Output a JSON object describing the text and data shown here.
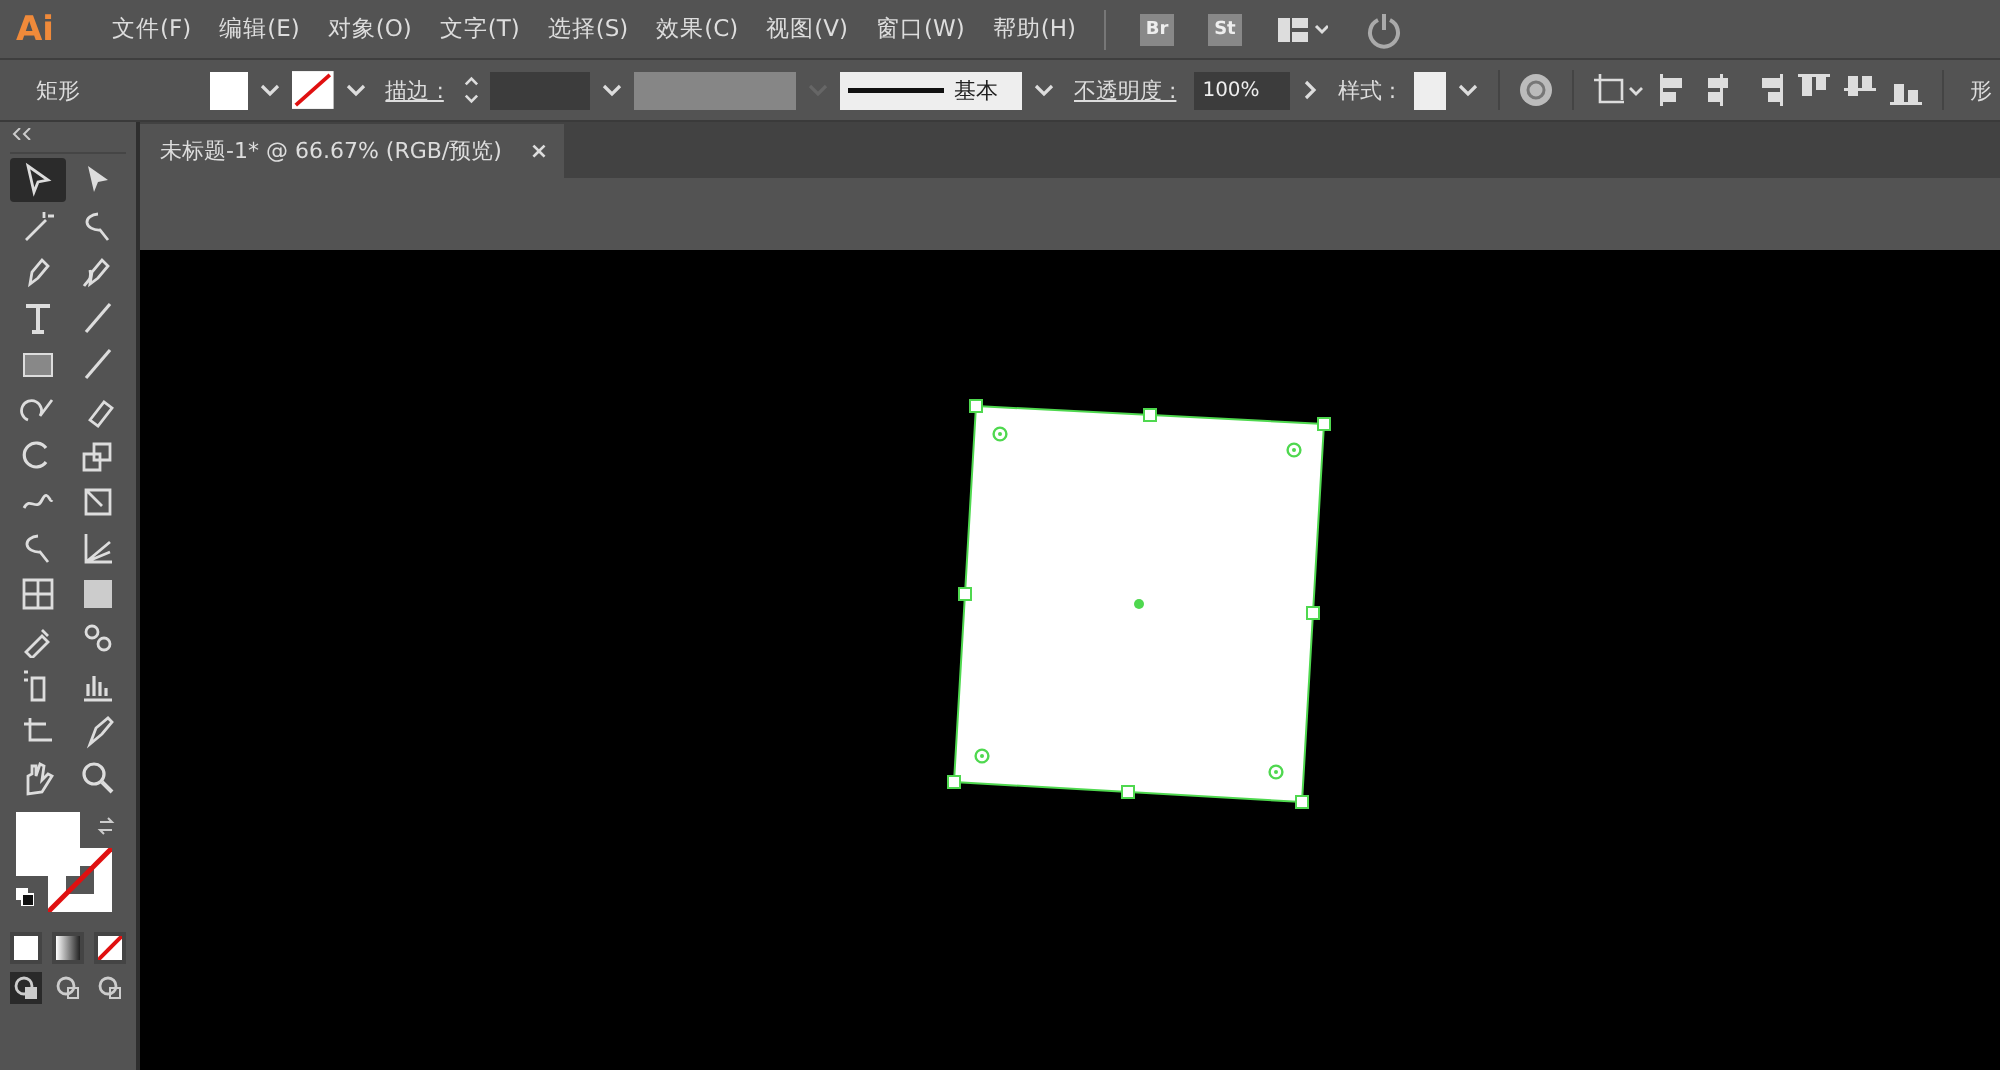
{
  "app": {
    "logo": "Ai"
  },
  "menu": [
    {
      "label": "文件(F)"
    },
    {
      "label": "编辑(E)"
    },
    {
      "label": "对象(O)"
    },
    {
      "label": "文字(T)"
    },
    {
      "label": "选择(S)"
    },
    {
      "label": "效果(C)"
    },
    {
      "label": "视图(V)"
    },
    {
      "label": "窗口(W)"
    },
    {
      "label": "帮助(H)"
    }
  ],
  "app_buttons": [
    "Br",
    "St"
  ],
  "control_bar": {
    "object_type": "矩形",
    "stroke_label": "描边 :",
    "stroke_profile": "基本",
    "opacity_label": "不透明度 :",
    "opacity": "100%",
    "style_label": "样式 :",
    "shape_label": "形"
  },
  "document_tab": {
    "title": "未标题-1* @ 66.67% (RGB/预览)",
    "close": "×"
  },
  "tools": [
    {
      "selected": true
    },
    {
      "selected": false
    },
    {
      "selected": false
    },
    {
      "selected": false
    },
    {
      "selected": false
    },
    {
      "selected": false
    },
    {
      "selected": false
    },
    {
      "selected": false
    },
    {
      "selected": false
    },
    {
      "selected": false
    },
    {
      "selected": false
    },
    {
      "selected": false
    },
    {
      "selected": false
    },
    {
      "selected": false
    },
    {
      "selected": false
    },
    {
      "selected": false
    },
    {
      "selected": false
    },
    {
      "selected": false
    },
    {
      "selected": false
    },
    {
      "selected": false
    },
    {
      "selected": false
    },
    {
      "selected": false
    },
    {
      "selected": false
    },
    {
      "selected": false
    },
    {
      "selected": false
    },
    {
      "selected": false
    },
    {
      "selected": false
    },
    {
      "selected": false
    }
  ],
  "draw_modes": [
    {
      "selected": true
    },
    {
      "selected": false
    },
    {
      "selected": false
    }
  ]
}
